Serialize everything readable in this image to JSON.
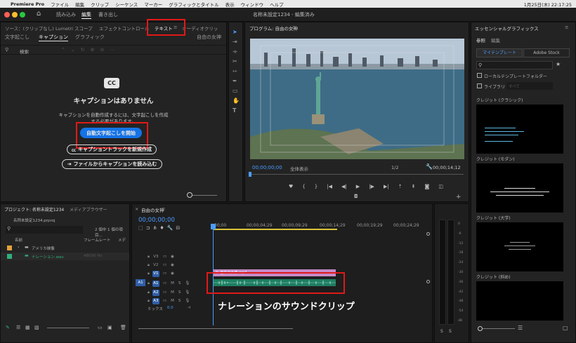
{
  "menubar": {
    "app": "Premiere Pro",
    "items": [
      "ファイル",
      "編集",
      "クリップ",
      "シーケンス",
      "マーカー",
      "グラフィックとタイトル",
      "表示",
      "ウィンドウ",
      "ヘルプ"
    ],
    "clock": "1月25日(木)  22:17:25"
  },
  "appbar": {
    "workspaces": [
      "読み込み",
      "編集",
      "書き出し"
    ],
    "title": "名称未設定1234 - 編集済み"
  },
  "left_tabs": [
    "ソース：(クリップなし)",
    "Lumetri スコープ",
    "エフェクトコントロール",
    "テキスト",
    "オーディオクリッ"
  ],
  "text_panel": {
    "subtabs": [
      "文字起こし",
      "キャプション",
      "グラフィック"
    ],
    "sequence_name": "自由の女神",
    "search_label": "検索",
    "cc_icon": "CC",
    "no_caption_title": "キャプションはありません",
    "desc_line1": "キャプションを自動作成するには、文字起こしを作成",
    "desc_line2": "する必要があります。",
    "start_transcribe_button": "自動文字起こしを開始",
    "new_track_button": "キャプショントラックを新規作成",
    "import_button": "ファイルからキャプションを読み込む"
  },
  "program": {
    "title": "プログラム: 自由の女神",
    "timecode": "00;00;00;00",
    "fit": "全体表示",
    "ratio": "1/2",
    "duration": "00;00;14;12"
  },
  "project": {
    "tab": "プロジェクト: 名称未設定1234",
    "media_tab": "メディアブラウザー",
    "file": "名称未設定1234.prproj",
    "selection": "2 個中 1 個の項目...",
    "col_name": "名前",
    "col_fps": "フレームレート",
    "col_media": "メデ",
    "folder": "アメリカ映像",
    "clip_name": "ナレーション.wav",
    "clip_fps": "48000 Hz"
  },
  "timeline": {
    "tab": "自由の女神",
    "timecode": "00;00;00;00",
    "ruler": [
      ":00;00",
      "00;00;04;29",
      "00;00;09;29",
      "00;00;14;29",
      "00;00;19;29",
      "00;00;24;29"
    ],
    "tracks": [
      "V3",
      "V2",
      "V1",
      "A1",
      "A2",
      "A3"
    ],
    "src_patch": "A1",
    "mix_label": "ミックス",
    "mix_value": "0.0",
    "video_clip": "自由の女神.mp4",
    "annotation": "ナレーションのサウンドクリップ",
    "meter_scale": [
      "0",
      "-6",
      "-12",
      "-18",
      "-24",
      "-30",
      "-36",
      "-42",
      "-48",
      "-54",
      "dB"
    ]
  },
  "essential_graphics": {
    "title": "エッセンシャルグラフィックス",
    "tabs": [
      "参照",
      "編集"
    ],
    "my_templates": "マイテンプレート",
    "adobe_stock": "Adobe Stock",
    "local_folder": "ローカルテンプレートフォルダー",
    "library": "ライブラリ",
    "library_value": "すべて",
    "templates": [
      "クレジット (クラシック)",
      "クレジット (モダン)",
      "クレジット (大学)",
      "クレジット (斜め)"
    ]
  }
}
